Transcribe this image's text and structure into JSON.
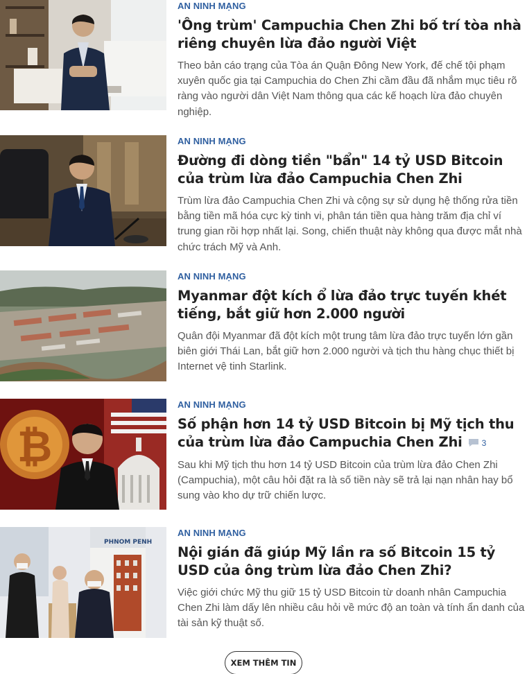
{
  "articles": [
    {
      "category": "AN NINH MẠNG",
      "title": "'Ông trùm' Campuchia Chen Zhi bố trí tòa nhà riêng chuyên lừa đảo người Việt",
      "summary": "Theo bản cáo trạng của Tòa án Quận Đông New York, đế chế tội phạm xuyên quốc gia tại Campuchia do Chen Zhi cầm đầu đã nhắm mục tiêu rõ ràng vào người dân Việt Nam thông qua các kế hoạch lừa đảo chuyên nghiệp."
    },
    {
      "category": "AN NINH MẠNG",
      "title": "Đường đi dòng tiền \"bẩn\" 14 tỷ USD Bitcoin của trùm lừa đảo Campuchia Chen Zhi",
      "summary": "Trùm lừa đảo Campuchia Chen Zhi và cộng sự sử dụng hệ thống rửa tiền bằng tiền mã hóa cực kỳ tinh vi, phân tán tiền qua hàng trăm địa chỉ ví trung gian rồi hợp nhất lại. Song, chiến thuật này không qua được mắt nhà chức trách Mỹ và Anh."
    },
    {
      "category": "AN NINH MẠNG",
      "title": "Myanmar đột kích ổ lừa đảo trực tuyến khét tiếng, bắt giữ hơn 2.000 người",
      "summary": "Quân đội Myanmar đã đột kích một trung tâm lừa đảo trực tuyến lớn gần biên giới Thái Lan, bắt giữ hơn 2.000 người và tịch thu hàng chục thiết bị Internet vệ tinh Starlink."
    },
    {
      "category": "AN NINH MẠNG",
      "title": "Số phận hơn 14 tỷ USD Bitcoin bị Mỹ tịch thu của trùm lừa đảo Campuchia Chen Zhi",
      "comment_count": "3",
      "summary": "Sau khi Mỹ tịch thu hơn 14 tỷ USD Bitcoin của trùm lừa đảo Chen Zhi (Campuchia), một câu hỏi đặt ra là số tiền này sẽ trả lại nạn nhân hay bổ sung vào kho dự trữ chiến lược."
    },
    {
      "category": "AN NINH MẠNG",
      "title": "Nội gián đã giúp Mỹ lần ra số Bitcoin 15 tỷ USD của ông trùm lừa đảo Chen Zhi?",
      "summary": "Việc giới chức Mỹ thu giữ 15 tỷ USD Bitcoin từ doanh nhân Campuchia Chen Zhi làm dấy lên nhiều câu hỏi về mức độ an toàn và tính ẩn danh của tài sản kỹ thuật số.",
      "sign_text": "PHNOM PENH"
    }
  ],
  "more_button": "XEM THÊM TIN",
  "colors": {
    "category": "#2f5fa0",
    "title": "#222222",
    "summary": "#555555"
  }
}
